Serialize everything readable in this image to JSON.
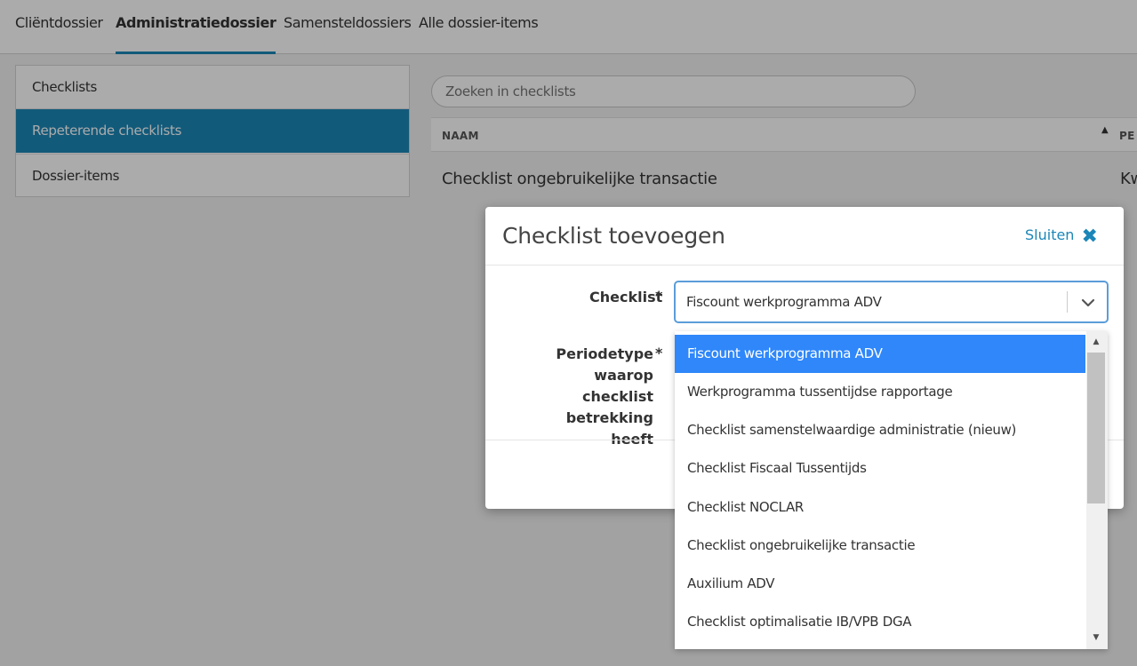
{
  "tabs": [
    {
      "label": "Cliëntdossier",
      "active": false
    },
    {
      "label": "Administratiedossier",
      "active": true
    },
    {
      "label": "Samensteldossiers",
      "active": false
    },
    {
      "label": "Alle dossier-items",
      "active": false
    }
  ],
  "submenu": [
    {
      "label": "Checklists",
      "active": false
    },
    {
      "label": "Repeterende checklists",
      "active": true
    },
    {
      "label": "Dossier-items",
      "active": false
    }
  ],
  "search": {
    "placeholder": "Zoeken in checklists"
  },
  "table": {
    "columns": [
      "NAAM",
      "PE"
    ],
    "rows": [
      {
        "name": "Checklist ongebruikelijke transactie",
        "period": "Kw"
      }
    ]
  },
  "modal": {
    "title": "Checklist toevoegen",
    "close_label": "Sluiten",
    "checklist_label": "Checklist",
    "period_label_line1": "Periodetype waarop",
    "period_label_line2": "checklist betrekking",
    "period_label_line3": "heeft",
    "required_mark": "*",
    "selected_value": "Fiscount werkprogramma ADV"
  },
  "dropdown": {
    "options": [
      "Fiscount werkprogramma ADV",
      "Werkprogramma tussentijdse rapportage",
      "Checklist samenstelwaardige administratie (nieuw)",
      "Checklist Fiscaal Tussentijds",
      "Checklist NOCLAR",
      "Checklist ongebruikelijke transactie",
      "Auxilium ADV",
      "Checklist optimalisatie IB/VPB DGA"
    ],
    "selected_index": 0
  },
  "colors": {
    "accent": "#1b86b7",
    "option_highlight": "#2f87fa"
  }
}
